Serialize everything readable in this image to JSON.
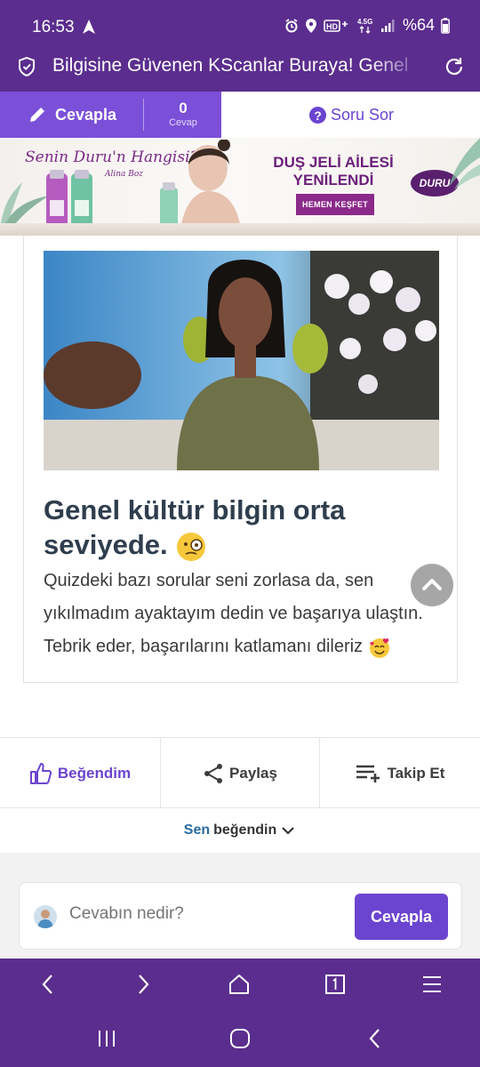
{
  "status_bar": {
    "time": "16:53",
    "battery": "%64",
    "network_label": "4.5G"
  },
  "url_bar": {
    "title": "Bilgisine Güvenen KScanlar Buraya! Genel"
  },
  "action_bar": {
    "answer_label": "Cevapla",
    "answer_count": "0",
    "answer_count_label": "Cevap",
    "ask_label": "Soru Sor"
  },
  "ad": {
    "script_text": "Senin Duru'n Hangisi?",
    "signature": "Alina Boz",
    "headline_line1": "DUŞ JELİ AİLESİ",
    "headline_line2": "YENİLENDİ",
    "cta": "HEMEN KEŞFET",
    "brand": "DURU"
  },
  "result": {
    "title": "Genel kültür bilgin orta seviyede.",
    "text": "Quizdeki bazı sorular seni zorlasa da, sen yıkılmadım ayaktayım dedin ve başarıya ulaştın. Tebrik eder, başarılarını katlamanı dileriz"
  },
  "reactions": {
    "like": "Beğendim",
    "share": "Paylaş",
    "follow": "Takip Et"
  },
  "liked_row": {
    "you": "Sen",
    "rest": "beğendin"
  },
  "comment": {
    "placeholder": "Cevabın nedir?",
    "submit": "Cevapla"
  },
  "colors": {
    "brand_purple": "#5b2d8e",
    "accent": "#6b44cf"
  }
}
